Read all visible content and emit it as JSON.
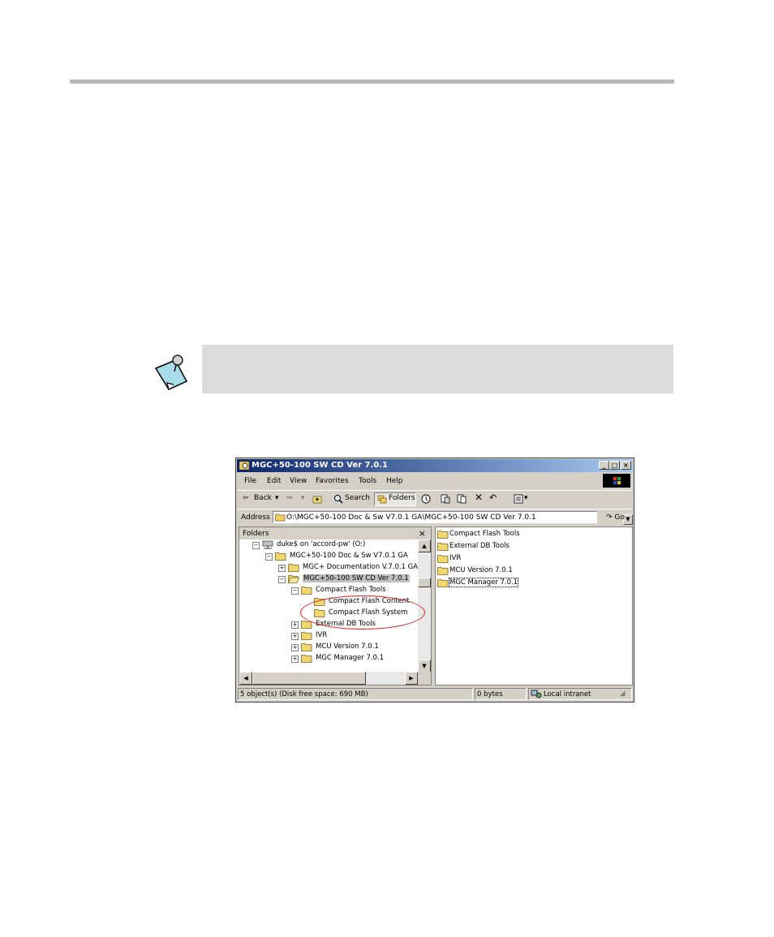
{
  "window": {
    "title": "MGC+50-100 SW CD Ver 7.0.1",
    "menu": [
      "File",
      "Edit",
      "View",
      "Favorites",
      "Tools",
      "Help"
    ],
    "toolbar": {
      "back_label": "Back",
      "search_label": "Search",
      "folders_label": "Folders"
    },
    "address": {
      "label": "Address",
      "value": "O:\\MGC+50-100 Doc & Sw V7.0.1 GA\\MGC+50-100 SW CD Ver 7.0.1",
      "go_label": "Go"
    },
    "folders_pane": {
      "header": "Folders",
      "tree": [
        {
          "label": "duke$ on 'accord-pw' (O:)",
          "expander": "−"
        },
        {
          "label": "MGC+50-100 Doc & Sw V7.0.1 GA",
          "expander": "−"
        },
        {
          "label": "MGC+ Documentation V.7.0.1 GA",
          "expander": "+"
        },
        {
          "label": "MGC+50-100 SW CD Ver 7.0.1",
          "expander": "−",
          "selected": true
        },
        {
          "label": "Compact Flash Tools",
          "expander": "−"
        },
        {
          "label": "Compact Flash Content",
          "expander": ""
        },
        {
          "label": "Compact Flash System",
          "expander": ""
        },
        {
          "label": "External DB Tools",
          "expander": "+"
        },
        {
          "label": "IVR",
          "expander": "+"
        },
        {
          "label": "MCU Version 7.0.1",
          "expander": "+"
        },
        {
          "label": "MGC Manager 7.0.1",
          "expander": "+"
        }
      ]
    },
    "files_pane": {
      "items": [
        "Compact Flash Tools",
        "External DB Tools",
        "IVR",
        "MCU Version 7.0.1",
        "MGC Manager 7.0.1"
      ]
    },
    "status": {
      "objects": "5 object(s) (Disk free space: 690 MB)",
      "size": "0 bytes",
      "zone": "Local intranet"
    }
  },
  "colors": {
    "rule": "#b8b8b8",
    "note_box": "#dcdcdc",
    "titlebar_start": "#0a246a",
    "highlight_circle": "#e02020"
  }
}
